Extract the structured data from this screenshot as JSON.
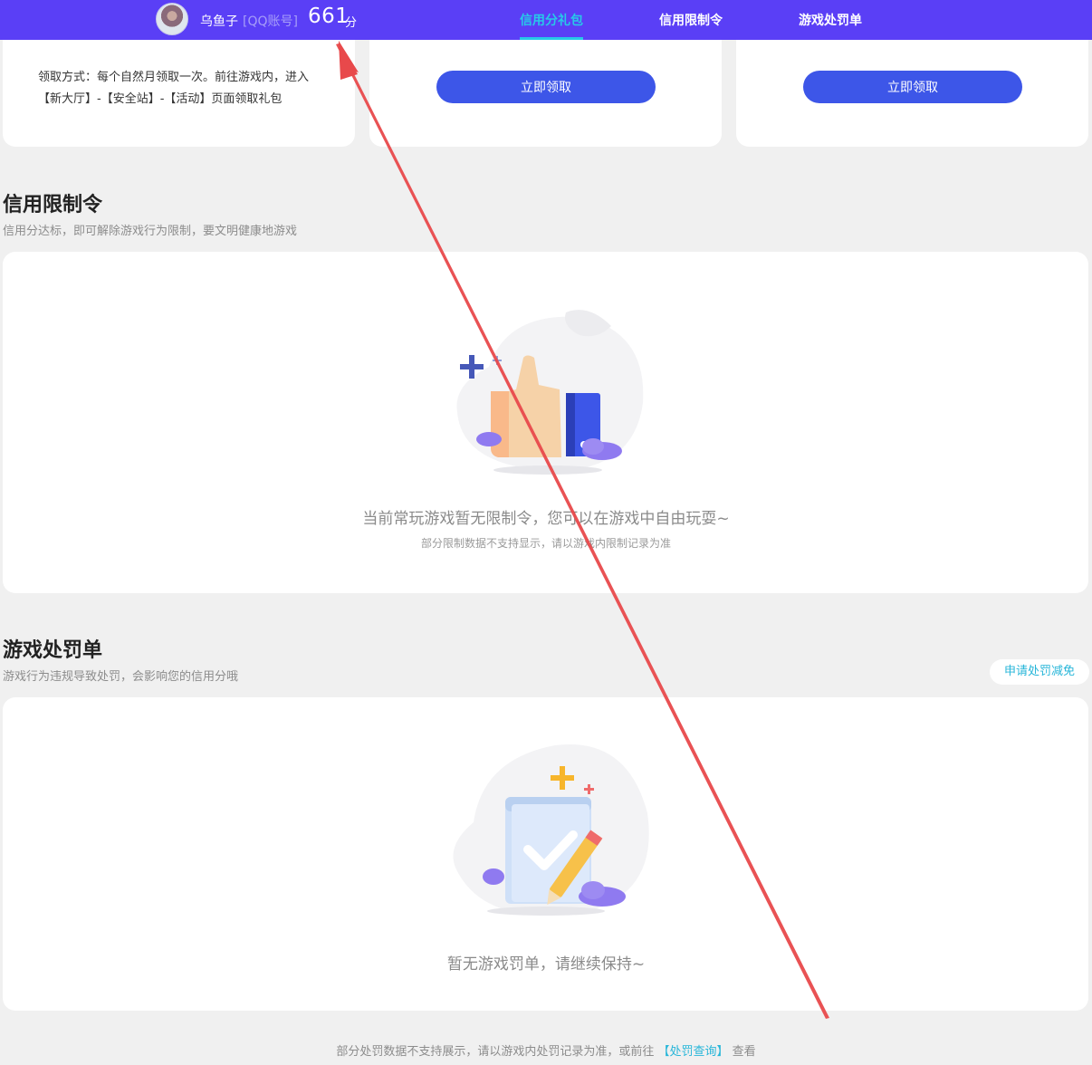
{
  "header": {
    "username": "乌鱼子",
    "account_tag": "[QQ账号]",
    "score": "661",
    "score_unit": "分",
    "tabs": [
      {
        "label": "信用分礼包",
        "active": true
      },
      {
        "label": "信用限制令",
        "active": false
      },
      {
        "label": "游戏处罚单",
        "active": false
      }
    ]
  },
  "gift_cards": {
    "method_text": "领取方式：每个自然月领取一次。前往游戏内，进入【新大厅】-【安全站】-【活动】页面领取礼包",
    "claim_button_1": "立即领取",
    "claim_button_2": "立即领取"
  },
  "restriction": {
    "title": "信用限制令",
    "subtitle": "信用分达标，即可解除游戏行为限制，要文明健康地游戏",
    "empty_main": "当前常玩游戏暂无限制令，您可以在游戏中自由玩耍~",
    "empty_sub": "部分限制数据不支持显示，请以游戏内限制记录为准"
  },
  "penalty": {
    "title": "游戏处罚单",
    "subtitle": "游戏行为违规导致处罚，会影响您的信用分哦",
    "appeal_button": "申请处罚减免",
    "empty_main": "暂无游戏罚单，请继续保持~"
  },
  "footer": {
    "text_before": "部分处罚数据不支持展示，请以游戏内处罚记录为准，或前往",
    "link": "【处罚查询】",
    "text_after": "查看"
  },
  "colors": {
    "header_bg": "#5a3ff6",
    "active_tab": "#27c9e8",
    "button_blue": "#3d56e8",
    "annotation_arrow": "#e8494b"
  }
}
